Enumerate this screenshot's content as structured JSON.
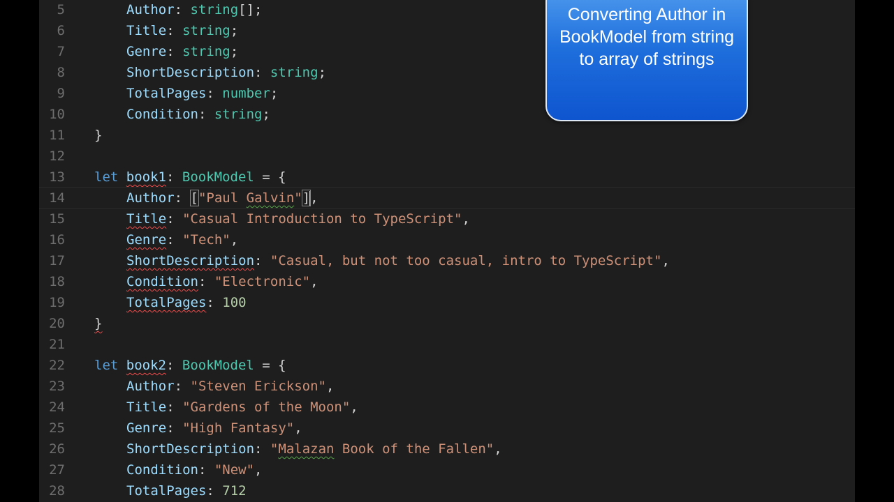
{
  "editor": {
    "lines": [
      {
        "num": "5",
        "indent": 2,
        "tokens": [
          {
            "t": "Author",
            "c": "prop"
          },
          {
            "t": ": ",
            "c": "punc"
          },
          {
            "t": "string",
            "c": "type"
          },
          {
            "t": "[];",
            "c": "punc"
          }
        ]
      },
      {
        "num": "6",
        "indent": 2,
        "tokens": [
          {
            "t": "Title",
            "c": "prop"
          },
          {
            "t": ": ",
            "c": "punc"
          },
          {
            "t": "string",
            "c": "type"
          },
          {
            "t": ";",
            "c": "punc"
          }
        ]
      },
      {
        "num": "7",
        "indent": 2,
        "tokens": [
          {
            "t": "Genre",
            "c": "prop"
          },
          {
            "t": ": ",
            "c": "punc"
          },
          {
            "t": "string",
            "c": "type"
          },
          {
            "t": ";",
            "c": "punc"
          }
        ]
      },
      {
        "num": "8",
        "indent": 2,
        "tokens": [
          {
            "t": "ShortDescription",
            "c": "prop"
          },
          {
            "t": ": ",
            "c": "punc"
          },
          {
            "t": "string",
            "c": "type"
          },
          {
            "t": ";",
            "c": "punc"
          }
        ]
      },
      {
        "num": "9",
        "indent": 2,
        "tokens": [
          {
            "t": "TotalPages",
            "c": "prop"
          },
          {
            "t": ": ",
            "c": "punc"
          },
          {
            "t": "number",
            "c": "type"
          },
          {
            "t": ";",
            "c": "punc"
          }
        ]
      },
      {
        "num": "10",
        "indent": 2,
        "tokens": [
          {
            "t": "Condition",
            "c": "prop"
          },
          {
            "t": ": ",
            "c": "punc"
          },
          {
            "t": "string",
            "c": "type"
          },
          {
            "t": ";",
            "c": "punc"
          }
        ]
      },
      {
        "num": "11",
        "indent": 1,
        "tokens": [
          {
            "t": "}",
            "c": "punc"
          }
        ]
      },
      {
        "num": "12",
        "indent": 0,
        "tokens": []
      },
      {
        "num": "13",
        "indent": 1,
        "tokens": [
          {
            "t": "let",
            "c": "kw"
          },
          {
            "t": " ",
            "c": "punc"
          },
          {
            "t": "book1",
            "c": "prop",
            "u": "err"
          },
          {
            "t": ": ",
            "c": "punc"
          },
          {
            "t": "BookModel",
            "c": "type"
          },
          {
            "t": " = {",
            "c": "punc"
          }
        ]
      },
      {
        "num": "14",
        "indent": 2,
        "current": true,
        "tokens": [
          {
            "t": "Author",
            "c": "prop"
          },
          {
            "t": ": ",
            "c": "punc"
          },
          {
            "t": "[",
            "c": "bracket"
          },
          {
            "t": "\"Paul ",
            "c": "str"
          },
          {
            "t": "Galvin",
            "c": "str",
            "u": "warn"
          },
          {
            "t": "\"",
            "c": "str"
          },
          {
            "t": "]",
            "c": "bracket"
          },
          {
            "t": "",
            "c": "cursor"
          },
          {
            "t": ",",
            "c": "punc"
          }
        ]
      },
      {
        "num": "15",
        "indent": 2,
        "tokens": [
          {
            "t": "Title",
            "c": "prop",
            "u": "err"
          },
          {
            "t": ": ",
            "c": "punc"
          },
          {
            "t": "\"Casual Introduction to TypeScript\"",
            "c": "str"
          },
          {
            "t": ",",
            "c": "punc"
          }
        ]
      },
      {
        "num": "16",
        "indent": 2,
        "tokens": [
          {
            "t": "Genre",
            "c": "prop",
            "u": "err"
          },
          {
            "t": ": ",
            "c": "punc"
          },
          {
            "t": "\"Tech\"",
            "c": "str"
          },
          {
            "t": ",",
            "c": "punc"
          }
        ]
      },
      {
        "num": "17",
        "indent": 2,
        "tokens": [
          {
            "t": "ShortDescription",
            "c": "prop",
            "u": "err"
          },
          {
            "t": ": ",
            "c": "punc"
          },
          {
            "t": "\"Casual, but not too casual, intro to TypeScript\"",
            "c": "str"
          },
          {
            "t": ",",
            "c": "punc"
          }
        ]
      },
      {
        "num": "18",
        "indent": 2,
        "tokens": [
          {
            "t": "Condition",
            "c": "prop",
            "u": "err"
          },
          {
            "t": ": ",
            "c": "punc"
          },
          {
            "t": "\"Electronic\"",
            "c": "str"
          },
          {
            "t": ",",
            "c": "punc"
          }
        ]
      },
      {
        "num": "19",
        "indent": 2,
        "tokens": [
          {
            "t": "TotalPages",
            "c": "prop",
            "u": "err"
          },
          {
            "t": ": ",
            "c": "punc"
          },
          {
            "t": "100",
            "c": "num"
          }
        ]
      },
      {
        "num": "20",
        "indent": 1,
        "tokens": [
          {
            "t": "}",
            "c": "punc",
            "u": "err"
          }
        ]
      },
      {
        "num": "21",
        "indent": 0,
        "tokens": []
      },
      {
        "num": "22",
        "indent": 1,
        "tokens": [
          {
            "t": "let",
            "c": "kw"
          },
          {
            "t": " ",
            "c": "punc"
          },
          {
            "t": "book2",
            "c": "prop",
            "u": "err"
          },
          {
            "t": ": ",
            "c": "punc"
          },
          {
            "t": "BookModel",
            "c": "type"
          },
          {
            "t": " = {",
            "c": "punc"
          }
        ]
      },
      {
        "num": "23",
        "indent": 2,
        "tokens": [
          {
            "t": "Author",
            "c": "prop"
          },
          {
            "t": ": ",
            "c": "punc"
          },
          {
            "t": "\"Steven Erickson\"",
            "c": "str"
          },
          {
            "t": ",",
            "c": "punc"
          }
        ]
      },
      {
        "num": "24",
        "indent": 2,
        "tokens": [
          {
            "t": "Title",
            "c": "prop"
          },
          {
            "t": ": ",
            "c": "punc"
          },
          {
            "t": "\"Gardens of the Moon\"",
            "c": "str"
          },
          {
            "t": ",",
            "c": "punc"
          }
        ]
      },
      {
        "num": "25",
        "indent": 2,
        "tokens": [
          {
            "t": "Genre",
            "c": "prop"
          },
          {
            "t": ": ",
            "c": "punc"
          },
          {
            "t": "\"High Fantasy\"",
            "c": "str"
          },
          {
            "t": ",",
            "c": "punc"
          }
        ]
      },
      {
        "num": "26",
        "indent": 2,
        "tokens": [
          {
            "t": "ShortDescription",
            "c": "prop"
          },
          {
            "t": ": ",
            "c": "punc"
          },
          {
            "t": "\"",
            "c": "str"
          },
          {
            "t": "Malazan",
            "c": "str",
            "u": "warn"
          },
          {
            "t": " Book of the Fallen\"",
            "c": "str"
          },
          {
            "t": ",",
            "c": "punc"
          }
        ]
      },
      {
        "num": "27",
        "indent": 2,
        "tokens": [
          {
            "t": "Condition",
            "c": "prop"
          },
          {
            "t": ": ",
            "c": "punc"
          },
          {
            "t": "\"New\"",
            "c": "str"
          },
          {
            "t": ",",
            "c": "punc"
          }
        ]
      },
      {
        "num": "28",
        "indent": 2,
        "tokens": [
          {
            "t": "TotalPages",
            "c": "prop"
          },
          {
            "t": ": ",
            "c": "punc"
          },
          {
            "t": "712",
            "c": "num"
          }
        ]
      }
    ]
  },
  "callout": {
    "text": "Converting Author in BookModel from string to array of strings"
  },
  "colors": {
    "editor_background": "#1e1e1e",
    "keyword": "#569cd6",
    "property": "#9cdcfe",
    "type": "#4ec9b0",
    "string": "#ce9178",
    "number": "#b5cea8",
    "line_number": "#6e6e6e",
    "error_squiggle": "#f14c4c",
    "warning_squiggle": "#57a64a",
    "callout_fill": "#1f6fdd"
  }
}
